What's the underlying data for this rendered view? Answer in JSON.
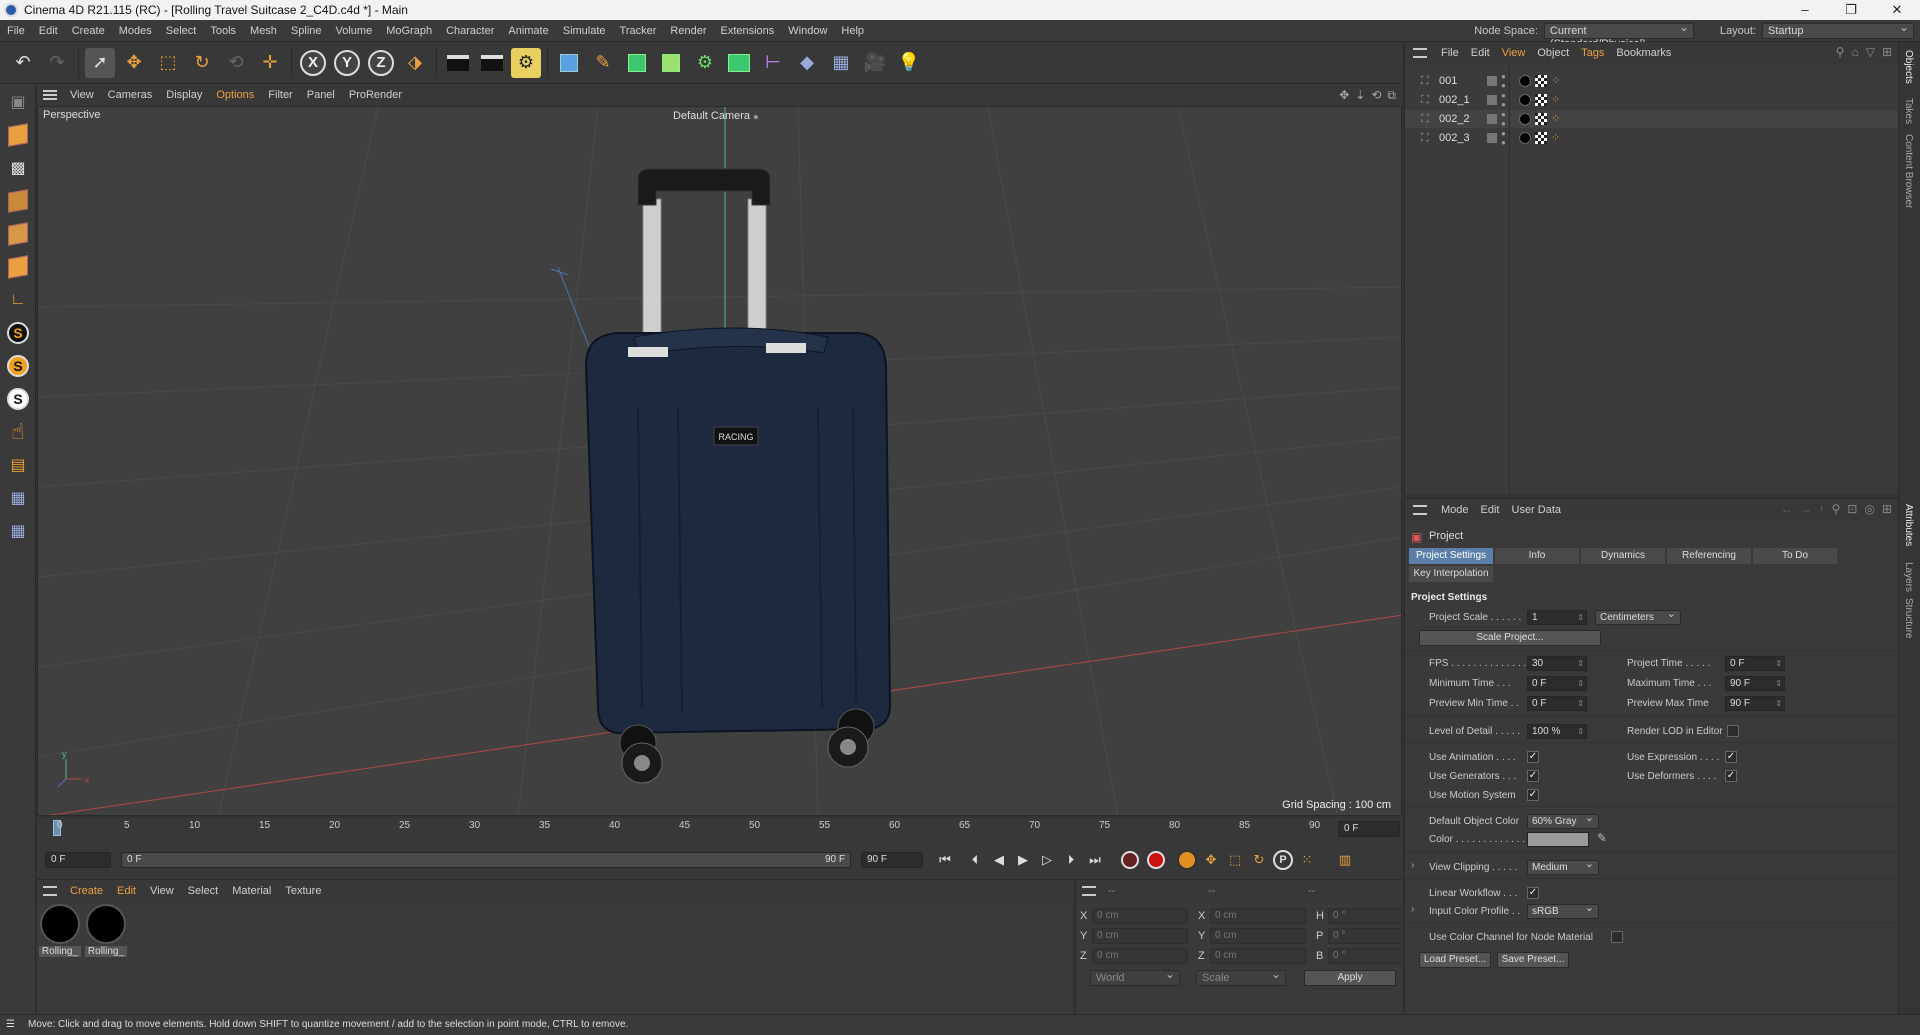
{
  "window": {
    "title": "Cinema 4D R21.115 (RC) - [Rolling Travel Suitcase 2_C4D.c4d *] - Main",
    "controls": [
      "–",
      "❐",
      "✕"
    ]
  },
  "menubar": {
    "items": [
      "File",
      "Edit",
      "Create",
      "Modes",
      "Select",
      "Tools",
      "Mesh",
      "Spline",
      "Volume",
      "MoGraph",
      "Character",
      "Animate",
      "Simulate",
      "Tracker",
      "Render",
      "Extensions",
      "Window",
      "Help"
    ],
    "node_space_label": "Node Space:",
    "node_space_value": "Current (Standard/Physical)",
    "layout_label": "Layout:",
    "layout_value": "Startup"
  },
  "viewport": {
    "menu": [
      "View",
      "Cameras",
      "Display",
      "Options",
      "Filter",
      "Panel",
      "ProRender"
    ],
    "label": "Perspective",
    "camera": "Default Camera",
    "grid_spacing": "Grid Spacing : 100 cm",
    "suitcase_brand": "RACING",
    "axis_x": "x",
    "axis_y": "y"
  },
  "timeline": {
    "ticks": [
      "0",
      "5",
      "10",
      "15",
      "20",
      "25",
      "30",
      "35",
      "40",
      "45",
      "50",
      "55",
      "60",
      "65",
      "70",
      "75",
      "80",
      "85",
      "90"
    ],
    "current_frame_right": "0 F",
    "start_field": "0 F",
    "range_start": "0 F",
    "range_end": "90 F",
    "end_field": "90 F"
  },
  "material_manager": {
    "menu": [
      "Create",
      "Edit",
      "View",
      "Select",
      "Material",
      "Texture"
    ],
    "materials": [
      {
        "label": "Rolling_"
      },
      {
        "label": "Rolling_"
      }
    ]
  },
  "coordinates": {
    "header": [
      "--",
      "--",
      "--"
    ],
    "rows": [
      {
        "a": "X",
        "av": "0 cm",
        "b": "X",
        "bv": "0 cm",
        "c": "H",
        "cv": "0 °"
      },
      {
        "a": "Y",
        "av": "0 cm",
        "b": "Y",
        "bv": "0 cm",
        "c": "P",
        "cv": "0 °"
      },
      {
        "a": "Z",
        "av": "0 cm",
        "b": "Z",
        "bv": "0 cm",
        "c": "B",
        "cv": "0 °"
      }
    ],
    "space": "World",
    "mode": "Scale",
    "apply": "Apply"
  },
  "status": "Move: Click and drag to move elements. Hold down SHIFT to quantize movement / add to the selection in point mode, CTRL to remove.",
  "objects": {
    "menu": [
      "File",
      "Edit",
      "View",
      "Object",
      "Tags",
      "Bookmarks"
    ],
    "items": [
      "001",
      "002_1",
      "002_2",
      "002_3"
    ]
  },
  "side_tabs": [
    "Objects",
    "Takes",
    "Content Browser",
    "Attributes",
    "Layers",
    "Structure"
  ],
  "attributes": {
    "menu": [
      "Mode",
      "Edit",
      "User Data"
    ],
    "object": "Project",
    "tabs": [
      "Project Settings",
      "Info",
      "Dynamics",
      "Referencing",
      "To Do"
    ],
    "tab2": "Key Interpolation",
    "section": "Project Settings",
    "project_scale_label": "Project Scale . . . . . .",
    "project_scale_value": "1",
    "project_scale_unit": "Centimeters",
    "scale_project_btn": "Scale Project...",
    "fps_label": "FPS . . . . . . . . . . . . . . .",
    "fps_value": "30",
    "project_time_label": "Project Time . . . . .",
    "project_time_value": "0 F",
    "min_time_label": "Minimum Time . . .",
    "min_time_value": "0 F",
    "max_time_label": "Maximum Time . . .",
    "max_time_value": "90 F",
    "prev_min_label": "Preview Min Time . .",
    "prev_min_value": "0 F",
    "prev_max_label": "Preview Max Time",
    "prev_max_value": "90 F",
    "lod_label": "Level of Detail . . . . .",
    "lod_value": "100 %",
    "render_lod_label": "Render LOD in Editor",
    "use_anim_label": "Use Animation . . . .",
    "use_expr_label": "Use Expression . . . .",
    "use_gen_label": "Use Generators . . .",
    "use_def_label": "Use Deformers . . . .",
    "use_motion_label": "Use Motion System",
    "def_obj_color_label": "Default Object Color",
    "def_obj_color_value": "60% Gray",
    "color_label": "Color . . . . . . . . . . . . .",
    "view_clipping_label": "View Clipping . . . . .",
    "view_clipping_value": "Medium",
    "linear_wf_label": "Linear Workflow . . .",
    "input_profile_label": "Input Color Profile . .",
    "input_profile_value": "sRGB",
    "color_channel_label": "Use Color Channel for Node Material",
    "load_preset": "Load Preset...",
    "save_preset": "Save Preset...",
    "checkmark": "✓"
  }
}
